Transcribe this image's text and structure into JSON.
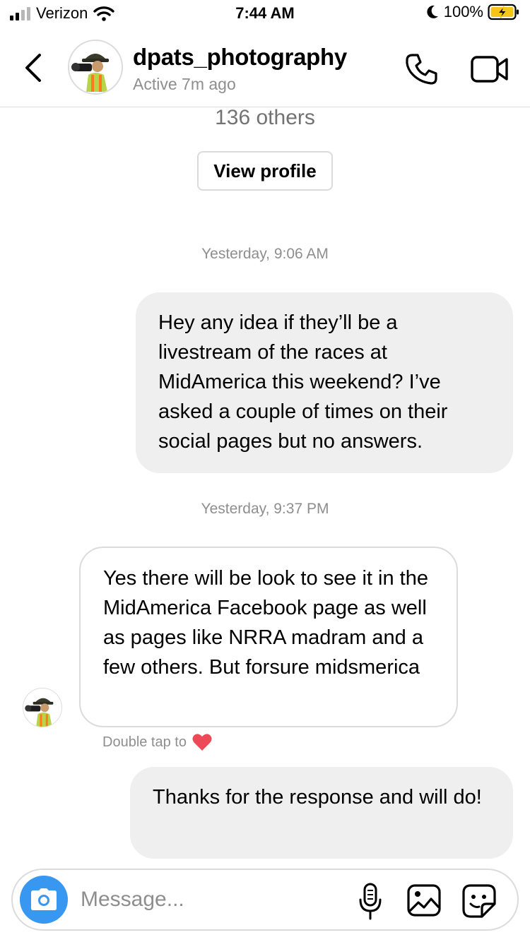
{
  "status_bar": {
    "carrier": "Verizon",
    "time": "7:44 AM",
    "battery": "100%"
  },
  "header": {
    "username": "dpats_photography",
    "activity": "Active 7m ago"
  },
  "profile_summary": {
    "followers_text": "136 others",
    "view_profile_label": "View profile"
  },
  "messages": [
    {
      "type": "timestamp",
      "text": "Yesterday, 9:06 AM"
    },
    {
      "type": "outgoing",
      "text": "Hey any idea if they’ll be a livestream of the races at MidAmerica this weekend? I’ve asked a couple of times on their social pages but no answers."
    },
    {
      "type": "timestamp",
      "text": "Yesterday, 9:37 PM"
    },
    {
      "type": "incoming",
      "text": "Yes there will be look to see it in the MidAmerica Facebook page as well as pages like NRRA madram and a few others. But forsure midsmerica"
    },
    {
      "type": "hint",
      "text": "Double tap to"
    },
    {
      "type": "outgoing",
      "text": "Thanks for the response and will do!"
    }
  ],
  "composer": {
    "placeholder": "Message..."
  },
  "colors": {
    "accent_blue": "#3897f0",
    "outgoing_bubble": "#efefef",
    "border": "#dbdbdb",
    "secondary_text": "#8e8e8e",
    "heart": "#ed4956",
    "battery_charging": "#f5c518"
  },
  "icons": [
    "signal-icon",
    "wifi-icon",
    "moon-icon",
    "battery-icon",
    "back-arrow-icon",
    "phone-icon",
    "video-camera-icon",
    "heart-icon",
    "camera-icon",
    "microphone-icon",
    "gallery-icon",
    "sticker-icon"
  ]
}
